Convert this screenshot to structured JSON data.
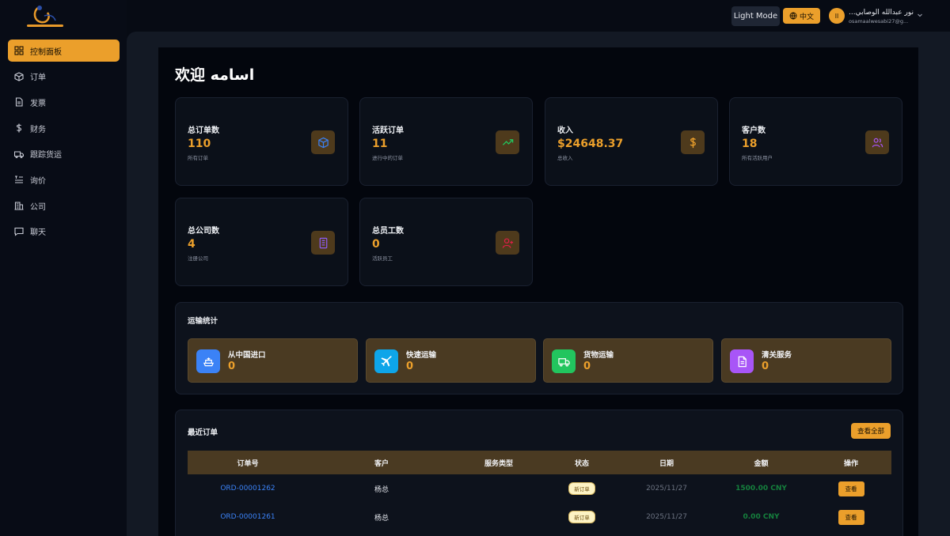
{
  "header": {
    "light_mode_label": "Light Mode",
    "language_label": "中文",
    "user_initials": "اا",
    "user_name": "...نور عبدالله الوصابي",
    "user_email": "osamaalwesabi27@g..."
  },
  "sidebar": {
    "items": [
      {
        "label": "控制面板",
        "icon": "grid-icon",
        "active": true
      },
      {
        "label": "订单",
        "icon": "box-icon"
      },
      {
        "label": "发票",
        "icon": "document-icon"
      },
      {
        "label": "财务",
        "icon": "dollar-icon"
      },
      {
        "label": "跟踪货运",
        "icon": "truck-icon"
      },
      {
        "label": "询价",
        "icon": "list-icon"
      },
      {
        "label": "公司",
        "icon": "building-icon"
      },
      {
        "label": "聊天",
        "icon": "chat-icon"
      }
    ]
  },
  "main": {
    "welcome": "欢迎 اسامه",
    "stats": [
      {
        "title": "总订单数",
        "value": "110",
        "sub": "所有订单",
        "icon": "cube-icon"
      },
      {
        "title": "活跃订单",
        "value": "11",
        "sub": "进行中的订单",
        "icon": "trending-up-icon"
      },
      {
        "title": "收入",
        "value": "$24648.37",
        "sub": "总收入",
        "icon": "dollar-icon"
      },
      {
        "title": "客户数",
        "value": "18",
        "sub": "所有活跃用户",
        "icon": "users-icon"
      },
      {
        "title": "总公司数",
        "value": "4",
        "sub": "注册公司",
        "icon": "building-icon"
      },
      {
        "title": "总员工数",
        "value": "0",
        "sub": "活跃员工",
        "icon": "user-plus-icon"
      }
    ],
    "shipping": {
      "title": "运输统计",
      "items": [
        {
          "label": "从中国进口",
          "value": "0",
          "icon": "ship-icon",
          "color": "#3b82f6"
        },
        {
          "label": "快速运输",
          "value": "0",
          "icon": "plane-icon",
          "color": "#0ea5e9"
        },
        {
          "label": "货物运输",
          "value": "0",
          "icon": "truck-icon",
          "color": "#22c55e"
        },
        {
          "label": "清关服务",
          "value": "0",
          "icon": "file-icon",
          "color": "#a855f7"
        }
      ]
    },
    "recent_orders": {
      "title": "最近订单",
      "view_all": "查看全部",
      "columns": [
        "订单号",
        "客户",
        "服务类型",
        "状态",
        "日期",
        "金额",
        "操作"
      ],
      "rows": [
        {
          "id": "ORD-00001262",
          "customer": "杨总",
          "service": "",
          "status": "新订单",
          "date": "2025/11/27",
          "amount": "1500.00 CNY",
          "action": "查看"
        },
        {
          "id": "ORD-00001261",
          "customer": "杨总",
          "service": "",
          "status": "新订单",
          "date": "2025/11/27",
          "amount": "0.00 CNY",
          "action": "查看"
        }
      ]
    }
  }
}
